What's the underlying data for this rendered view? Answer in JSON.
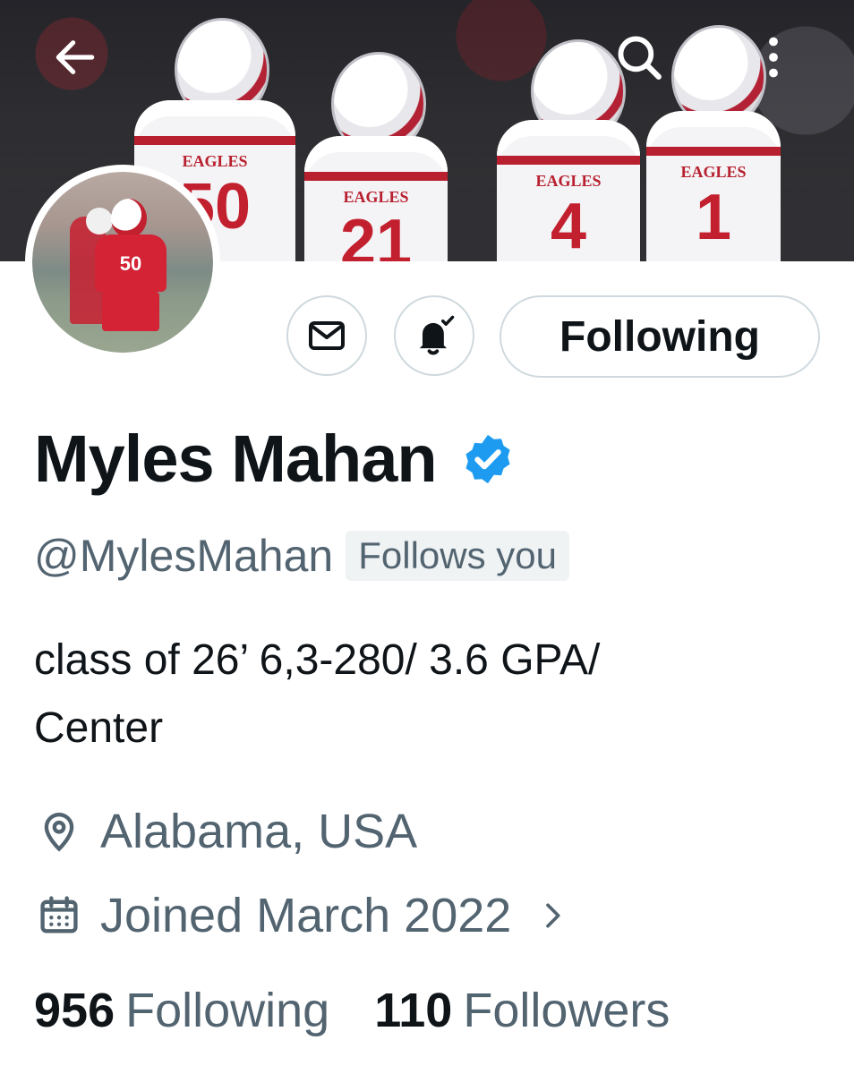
{
  "profile": {
    "name": "Myles Mahan",
    "handle": "@MylesMahan",
    "follows_you": "Follows you",
    "bio_line1": "class of 26’ 6,3-280/ 3.6 GPA/",
    "bio_line2": "Center",
    "location": "Alabama, USA",
    "joined": "Joined March 2022",
    "following_count": "956",
    "following_label": "Following",
    "followers_count": "110",
    "followers_label": "Followers"
  },
  "actions": {
    "follow_state": "Following"
  },
  "banner": {
    "jersey_text": "EAGLES",
    "numbers": [
      "50",
      "21",
      "4",
      "1"
    ]
  },
  "avatar": {
    "jersey_number": "50"
  },
  "icons": {
    "back": "arrow-left-icon",
    "search": "search-icon",
    "more": "more-vertical-icon",
    "message": "envelope-icon",
    "notify": "bell-check-icon",
    "verified": "verified-badge-icon",
    "location": "location-pin-icon",
    "calendar": "calendar-icon",
    "chevron": "chevron-right-icon"
  },
  "colors": {
    "verified": "#1d9bf0",
    "text_primary": "#0f1419",
    "text_secondary": "#536471",
    "border": "#cfd9de"
  }
}
